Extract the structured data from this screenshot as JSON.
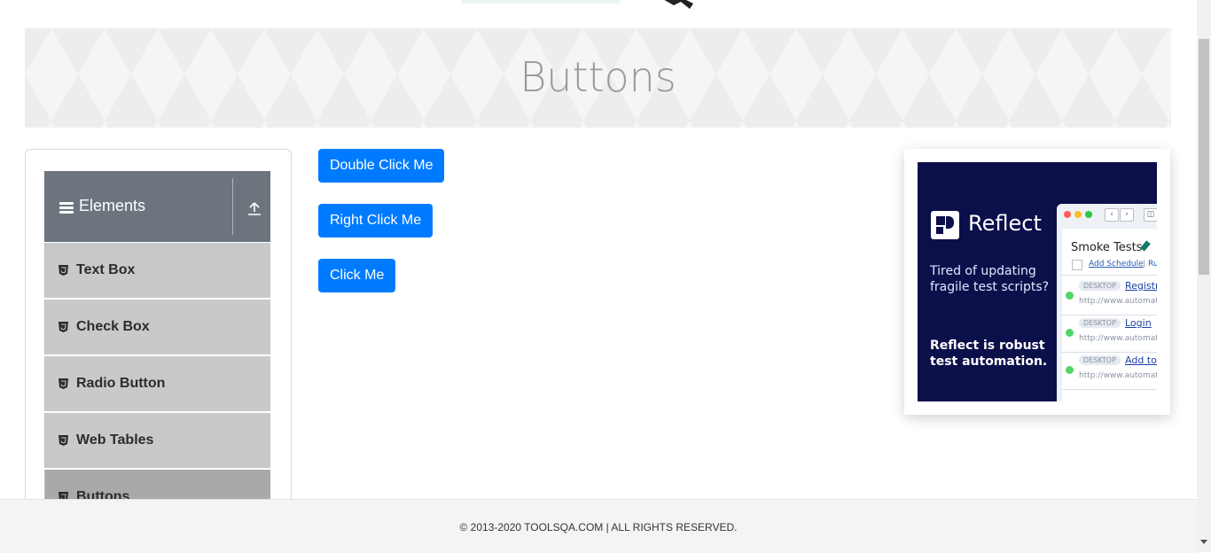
{
  "page": {
    "title": "Buttons"
  },
  "sidebar": {
    "group_title": "Elements",
    "group_icon": "hamburger-icon",
    "collapse_icon": "upload-arrow-icon",
    "items": [
      {
        "label": "Text Box",
        "icon": "html5-icon"
      },
      {
        "label": "Check Box",
        "icon": "html5-icon"
      },
      {
        "label": "Radio Button",
        "icon": "html5-icon"
      },
      {
        "label": "Web Tables",
        "icon": "html5-icon"
      },
      {
        "label": "Buttons",
        "icon": "html5-icon",
        "active": true
      }
    ]
  },
  "buttons": {
    "double_click": "Double Click Me",
    "right_click": "Right Click Me",
    "click": "Click Me"
  },
  "ad": {
    "brand": "Reflect",
    "tagline": "Tired of updating fragile test scripts?",
    "tagline2": "Reflect is robust test automation.",
    "browser": {
      "panel_title": "Smoke Tests",
      "add_schedule": "Add Schedule",
      "separator": "|",
      "ru": "Ru",
      "runs": [
        {
          "tag": "DESKTOP",
          "name": "Registr",
          "url": "http://www.automat"
        },
        {
          "tag": "DESKTOP",
          "name": "Login",
          "url": "http://www.automat"
        },
        {
          "tag": "DESKTOP",
          "name": "Add to",
          "url": "http://www.automat"
        }
      ]
    }
  },
  "footer": {
    "text": "© 2013-2020 TOOLSQA.COM | ALL RIGHTS RESERVED."
  },
  "colors": {
    "primary_button": "#007bff",
    "sidebar_header": "#6c757d",
    "menu_item": "#c9c9c9",
    "menu_item_active": "#a9a9a9",
    "ad_background": "#0b0f4a"
  }
}
